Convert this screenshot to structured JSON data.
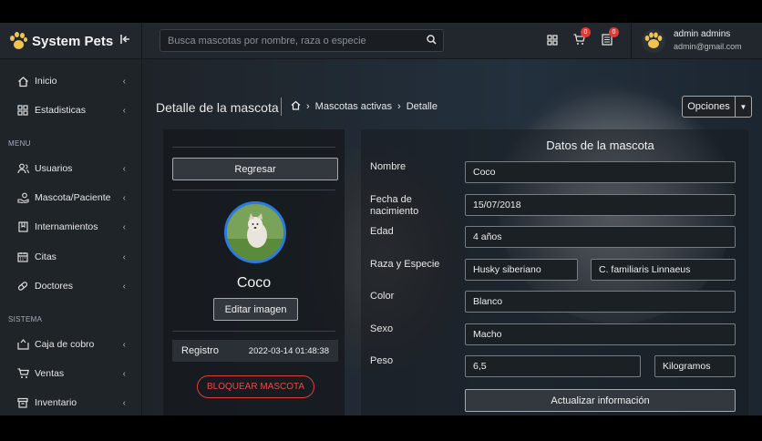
{
  "brand": {
    "name": "System Pets"
  },
  "search": {
    "placeholder": "Busca mascotas por nombre, raza o especie"
  },
  "topbar": {
    "cart_badge": "0",
    "list_badge": "0"
  },
  "user": {
    "name": "admin admins",
    "email": "admin@gmail.com"
  },
  "sidebar": {
    "items_top": [
      {
        "label": "Inicio"
      },
      {
        "label": "Estadisticas"
      }
    ],
    "section_menu": "MENU",
    "items_menu": [
      {
        "label": "Usuarios"
      },
      {
        "label": "Mascota/Paciente"
      },
      {
        "label": "Internamientos"
      },
      {
        "label": "Citas"
      },
      {
        "label": "Doctores"
      }
    ],
    "section_sistema": "SISTEMA",
    "items_sistema": [
      {
        "label": "Caja de cobro"
      },
      {
        "label": "Ventas"
      },
      {
        "label": "Inventario"
      }
    ]
  },
  "page": {
    "title": "Detalle de la mascota",
    "breadcrumb": [
      "Mascotas activas",
      "Detalle"
    ],
    "options_label": "Opciones"
  },
  "pet_card": {
    "back_label": "Regresar",
    "name": "Coco",
    "edit_image_label": "Editar imagen",
    "registro_label": "Registro",
    "registro_value": "2022-03-14 01:48:38",
    "block_label": "BLOQUEAR MASCOTA"
  },
  "form": {
    "title": "Datos de la mascota",
    "nombre_label": "Nombre",
    "nombre_value": "Coco",
    "fecha_label": "Fecha de nacimiento",
    "fecha_value": "15/07/2018",
    "edad_label": "Edad",
    "edad_value": "4 años",
    "raza_label": "Raza y Especie",
    "raza_value": "Husky siberiano",
    "especie_value": "C. familiaris Linnaeus",
    "color_label": "Color",
    "color_value": "Blanco",
    "sexo_label": "Sexo",
    "sexo_value": "Macho",
    "peso_label": "Peso",
    "peso_value": "6,5",
    "peso_unit": "Kilogramos",
    "update_label": "Actualizar información"
  },
  "colors": {
    "accent_blue": "#2a7be0",
    "danger": "#e13b3b",
    "badge": "#e53935",
    "brand_paw": "#f0c451"
  }
}
